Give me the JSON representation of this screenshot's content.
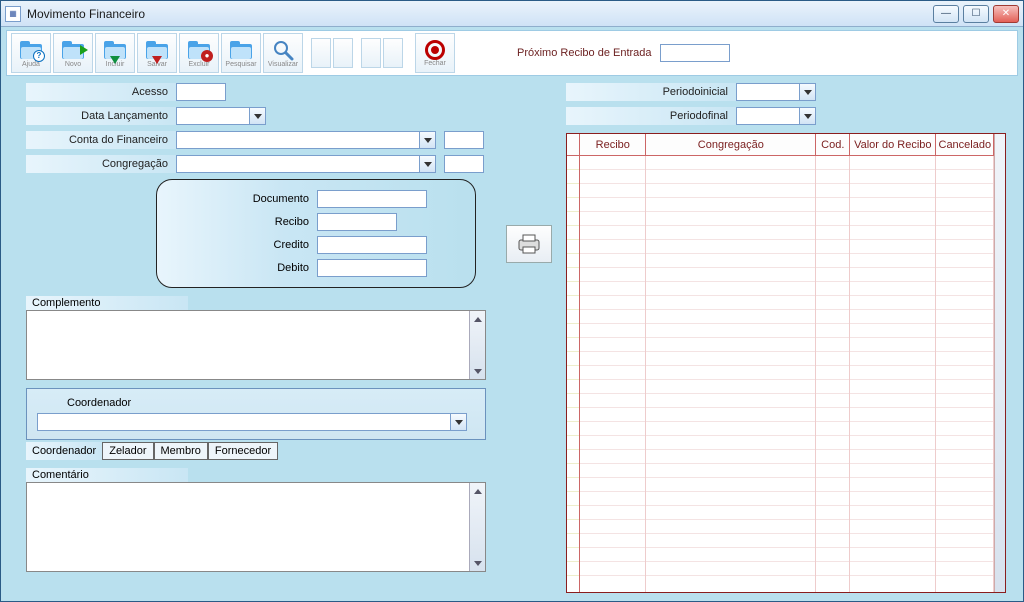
{
  "window": {
    "title": "Movimento Financeiro"
  },
  "toolbar": {
    "buttons": [
      {
        "label": "Ajuda",
        "badge": "?",
        "badge_color": "#0a70c0"
      },
      {
        "label": "Novo",
        "badge": "",
        "badge_color": "#1aa01a",
        "arrow": "right",
        "arrow_color": "#1aa01a"
      },
      {
        "label": "Incluir",
        "badge": "",
        "badge_color": "#109040",
        "arrow": "down",
        "arrow_color": "#109040"
      },
      {
        "label": "Salvar",
        "badge": "",
        "badge_color": "#c02020",
        "arrow": "down",
        "arrow_color": "#c02020"
      },
      {
        "label": "Excluir",
        "badge": "",
        "badge_color": "#b01010",
        "dot": true
      },
      {
        "label": "Pesquisar",
        "badge": "",
        "badge_color": "#555"
      },
      {
        "label": "Visualizar",
        "badge": "",
        "badge_color": "#555",
        "magnifier": true
      }
    ],
    "fechar_label": "Fechar"
  },
  "proximo": {
    "label": "Próximo Recibo de Entrada",
    "value": ""
  },
  "fields": {
    "acesso_label": "Acesso",
    "acesso_value": "",
    "data_lanc_label": "Data Lançamento",
    "data_lanc_value": "",
    "conta_label": "Conta do Financeiro",
    "conta_value": "",
    "conta_code": "",
    "congreg_label": "Congregação",
    "congreg_value": "",
    "congreg_code": ""
  },
  "docbox": {
    "documento_label": "Documento",
    "documento_value": "",
    "recibo_label": "Recibo",
    "recibo_value": "",
    "credito_label": "Credito",
    "credito_value": "",
    "debito_label": "Debito",
    "debito_value": ""
  },
  "complemento": {
    "label": "Complemento",
    "value": ""
  },
  "coordenador": {
    "label": "Coordenador",
    "value": "",
    "tab_label": "Coordenador",
    "tabs": [
      "Zelador",
      "Membro",
      "Fornecedor"
    ]
  },
  "comentario": {
    "label": "Comentário",
    "value": ""
  },
  "periodo": {
    "inicial_label": "Periodoinicial",
    "inicial_value": "",
    "final_label": "Periodofinal",
    "final_value": ""
  },
  "grid": {
    "columns": [
      {
        "label": "Recibo",
        "width": 66
      },
      {
        "label": "Congregação",
        "width": 170
      },
      {
        "label": "Cod.",
        "width": 34
      },
      {
        "label": "Valor do Recibo",
        "width": 86
      },
      {
        "label": "Cancelado",
        "width": 58
      }
    ],
    "rows": []
  }
}
